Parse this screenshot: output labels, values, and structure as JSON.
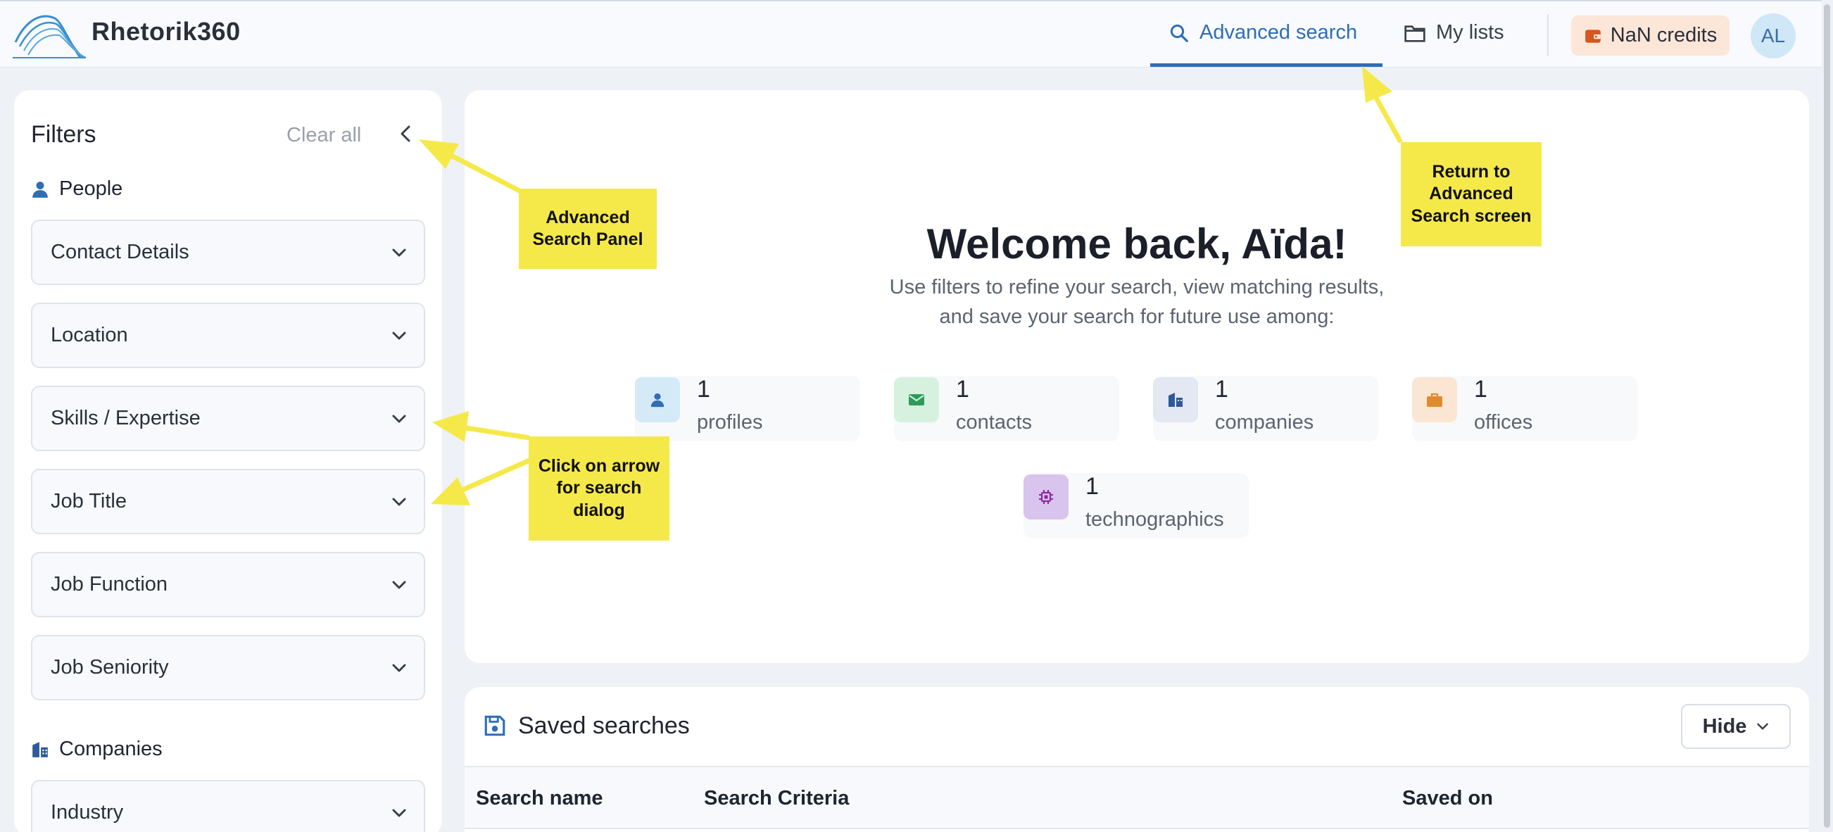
{
  "app": {
    "name": "Rhetorik360"
  },
  "nav": {
    "advanced_search": "Advanced search",
    "my_lists": "My lists",
    "credits": "NaN credits",
    "avatar_initials": "AL"
  },
  "filters": {
    "title": "Filters",
    "clear_all": "Clear all",
    "people_heading": "People",
    "people_items": [
      {
        "label": "Contact Details"
      },
      {
        "label": "Location"
      },
      {
        "label": "Skills / Expertise"
      },
      {
        "label": "Job Title"
      },
      {
        "label": "Job Function"
      },
      {
        "label": "Job Seniority"
      }
    ],
    "companies_heading": "Companies",
    "companies_items": [
      {
        "label": "Industry"
      }
    ]
  },
  "welcome": {
    "title": "Welcome back, Aïda!",
    "subtitle_line1": "Use filters to refine your search, view matching results,",
    "subtitle_line2": "and save your search for future use among:",
    "stats": [
      {
        "count": "1",
        "label": "profiles",
        "icon": "person-icon",
        "color": "#d4eaf7"
      },
      {
        "count": "1",
        "label": "contacts",
        "icon": "mail-icon",
        "color": "#d6f2df"
      },
      {
        "count": "1",
        "label": "companies",
        "icon": "building-icon",
        "color": "#e3e8f2"
      },
      {
        "count": "1",
        "label": "offices",
        "icon": "briefcase-icon",
        "color": "#fbe6d3"
      },
      {
        "count": "1",
        "label": "technographics",
        "icon": "chip-icon",
        "color": "#d8c4ec"
      }
    ]
  },
  "saved_searches": {
    "title": "Saved searches",
    "hide_label": "Hide",
    "columns": [
      "Search name",
      "Search Criteria",
      "Saved on"
    ]
  },
  "annotations": {
    "advanced_search_panel": [
      "Advanced",
      "Search Panel"
    ],
    "return_to_advanced": [
      "Return to",
      "Advanced",
      "Search screen"
    ],
    "click_on_arrow": [
      "Click on arrow",
      "for search",
      "dialog"
    ]
  },
  "colors": {
    "accent": "#2f6db5",
    "callout": "#f5e94a",
    "credits_bg": "#fbe6d8"
  }
}
